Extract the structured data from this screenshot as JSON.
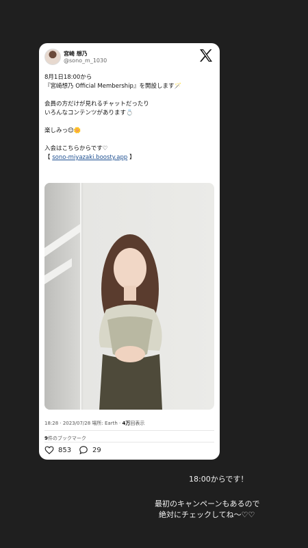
{
  "tweet": {
    "display_name": "宮崎 想乃",
    "handle": "@sono_m_1030",
    "lines": [
      "8月1日18:00から",
      "『宮崎想乃 Official Membership』を開設します🪄",
      "",
      "会員の方だけが見れるチャットだったり",
      "いろんなコンテンツがあります💍",
      "",
      "楽しみっ😊🌼",
      "",
      "入会はこちらからです♡"
    ],
    "link_prefix": "【 ",
    "link_text": "sono-miyazaki.boosty.app",
    "link_suffix": " 】",
    "meta_time": "18:28 · 2023/07/28 場所: Earth · ",
    "meta_views_count": "4万",
    "meta_views_label": "回表示",
    "bookmarks_count": "9",
    "bookmarks_label": "件のブックマーク",
    "likes": "853",
    "replies": "29"
  },
  "icons": {
    "logo": "x-logo-icon",
    "like": "heart-icon",
    "reply": "speech-bubble-icon"
  },
  "story": {
    "line1": "18:00からです！",
    "line2": "最初のキャンペーンもあるので",
    "line3": "絶対にチェックしてね〜♡♡"
  }
}
